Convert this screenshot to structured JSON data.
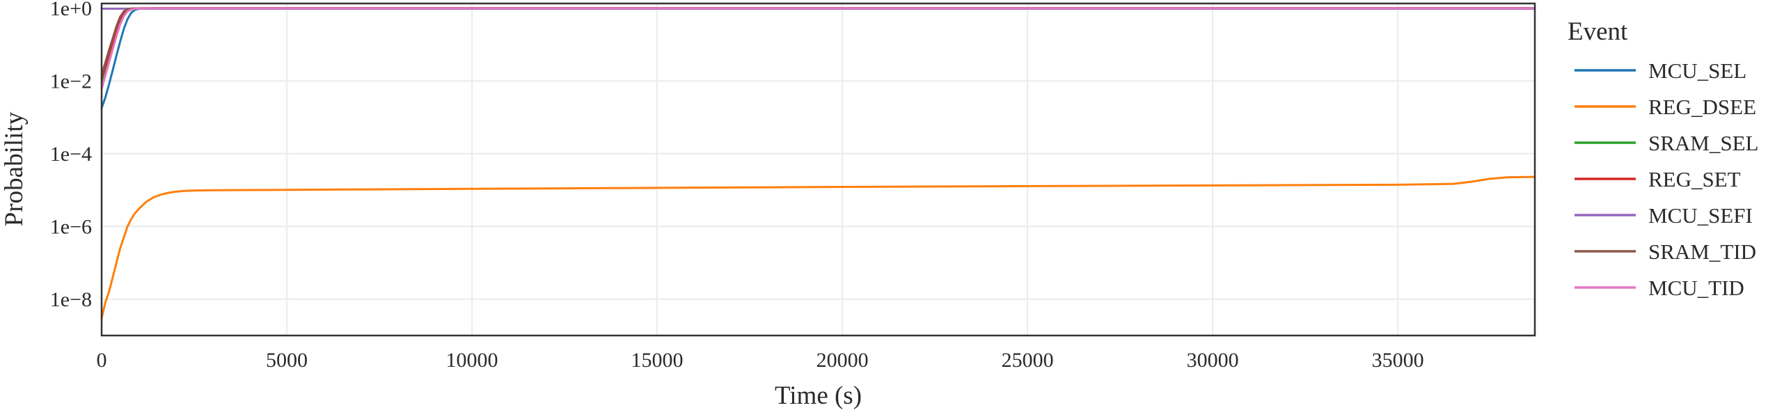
{
  "chart_data": {
    "type": "line",
    "title": "",
    "xlabel": "Time (s)",
    "ylabel": "Probability",
    "xlim": [
      0,
      38700
    ],
    "ylim": [
      1e-09,
      1.35
    ],
    "yscale": "log",
    "grid": true,
    "x_ticks": [
      0,
      5000,
      10000,
      15000,
      20000,
      25000,
      30000,
      35000
    ],
    "x_tick_labels": [
      "0",
      "5000",
      "10000",
      "15000",
      "20000",
      "25000",
      "30000",
      "35000"
    ],
    "y_ticks": [
      1e-08,
      1e-06,
      0.0001,
      0.01,
      1
    ],
    "y_tick_labels": [
      "1e−8",
      "1e−6",
      "1e−4",
      "1e−2",
      "1e+0"
    ],
    "legend": {
      "title": "Event",
      "placement": "right"
    },
    "series": [
      {
        "name": "MCU_SEL",
        "color": "#1f77b4",
        "x": [
          0,
          100,
          200,
          300,
          400,
          500,
          600,
          700,
          800,
          900,
          1000,
          1200,
          1500,
          2000,
          5000,
          10000,
          20000,
          30000,
          38700
        ],
        "y": [
          0.0018,
          0.0035,
          0.008,
          0.02,
          0.05,
          0.12,
          0.27,
          0.5,
          0.75,
          0.9,
          0.96,
          0.99,
          1,
          1,
          1,
          1,
          1,
          1,
          1
        ]
      },
      {
        "name": "REG_DSEE",
        "color": "#ff7f0e",
        "x": [
          0,
          100,
          200,
          300,
          400,
          500,
          600,
          700,
          800,
          900,
          1000,
          1200,
          1400,
          1600,
          1800,
          2000,
          2200,
          2500,
          3000,
          4000,
          5000,
          7000,
          10000,
          15000,
          20000,
          25000,
          30000,
          35000,
          36500,
          37000,
          37500,
          38000,
          38700
        ],
        "y": [
          3e-09,
          8e-09,
          1.6e-08,
          4e-08,
          1e-07,
          2.5e-07,
          5e-07,
          1e-06,
          1.6e-06,
          2.3e-06,
          3e-06,
          4.7e-06,
          6.3e-06,
          7.5e-06,
          8.4e-06,
          9e-06,
          9.4e-06,
          9.7e-06,
          9.9e-06,
          1e-05,
          1.01e-05,
          1.04e-05,
          1.08e-05,
          1.15e-05,
          1.22e-05,
          1.28e-05,
          1.34e-05,
          1.4e-05,
          1.48e-05,
          1.7e-05,
          2.05e-05,
          2.25e-05,
          2.3e-05
        ]
      },
      {
        "name": "SRAM_SEL",
        "color": "#2ca02c",
        "x": [
          0,
          100,
          200,
          300,
          400,
          500,
          600,
          700,
          800,
          1000,
          1500,
          5000,
          10000,
          20000,
          30000,
          38700
        ],
        "y": [
          0.009,
          0.018,
          0.04,
          0.09,
          0.2,
          0.4,
          0.65,
          0.85,
          0.95,
          0.99,
          1,
          1,
          1,
          1,
          1,
          1
        ]
      },
      {
        "name": "REG_SET",
        "color": "#d62728",
        "x": [
          0,
          100,
          200,
          300,
          400,
          500,
          600,
          700,
          800,
          1000,
          1500,
          5000,
          10000,
          20000,
          30000,
          38700
        ],
        "y": [
          0.012,
          0.025,
          0.055,
          0.12,
          0.26,
          0.5,
          0.75,
          0.9,
          0.97,
          0.995,
          1,
          1,
          1,
          1,
          1,
          1
        ]
      },
      {
        "name": "MCU_SEFI",
        "color": "#9467bd",
        "x": [
          0,
          5000,
          10000,
          15000,
          20000,
          25000,
          30000,
          35000,
          38700
        ],
        "y": [
          0.97,
          0.97,
          0.97,
          0.97,
          0.97,
          0.97,
          0.97,
          0.97,
          0.97
        ]
      },
      {
        "name": "SRAM_TID",
        "color": "#8c564b",
        "x": [
          0,
          100,
          200,
          300,
          400,
          500,
          600,
          700,
          800,
          1000,
          1500,
          5000,
          10000,
          20000,
          30000,
          38700
        ],
        "y": [
          0.015,
          0.032,
          0.07,
          0.15,
          0.32,
          0.58,
          0.82,
          0.94,
          0.985,
          0.998,
          1,
          1,
          1,
          1,
          1,
          1
        ]
      },
      {
        "name": "MCU_TID",
        "color": "#e377c2",
        "x": [
          0,
          100,
          200,
          300,
          400,
          500,
          600,
          700,
          800,
          1000,
          1500,
          5000,
          10000,
          20000,
          30000,
          38700
        ],
        "y": [
          0.006,
          0.014,
          0.032,
          0.075,
          0.17,
          0.36,
          0.6,
          0.82,
          0.93,
          0.99,
          1,
          1,
          1,
          1,
          1,
          1
        ]
      }
    ]
  }
}
